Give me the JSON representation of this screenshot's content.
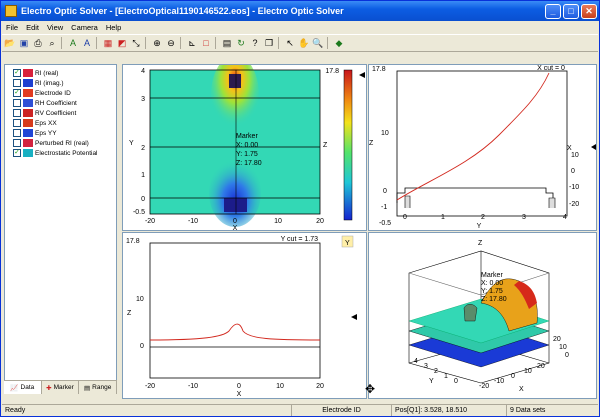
{
  "window": {
    "title": "Electro Optic Solver - [ElectroOptical1190146522.eos] - Electro Optic Solver",
    "minimize": "_",
    "maximize": "□",
    "close": "✕"
  },
  "menu": [
    "File",
    "Edit",
    "View",
    "Camera",
    "Help"
  ],
  "toolbar_icons": [
    "open-icon",
    "save-icon",
    "print-icon",
    "print-preview-icon",
    "text-color-icon",
    "font-icon",
    "grid-icon",
    "image-icon",
    "fit-icon",
    "zoom-in-icon",
    "zoom-out-icon",
    "axes-icon",
    "box-icon",
    "layout-icon",
    "refresh-icon",
    "marker-icon",
    "copy-icon",
    "pointer-icon",
    "pan-icon",
    "zoom-icon",
    "cube-icon"
  ],
  "layers": [
    {
      "label": "RI (real)",
      "checked": true,
      "color": "#d8203a"
    },
    {
      "label": "RI (imag.)",
      "checked": false,
      "color": "#1d3fd1"
    },
    {
      "label": "Electrode ID",
      "checked": true,
      "color": "#e13a20"
    },
    {
      "label": "RH Coefficient",
      "checked": false,
      "color": "#2e4fd6"
    },
    {
      "label": "RV Coefficient",
      "checked": false,
      "color": "#cc2424"
    },
    {
      "label": "Eps XX",
      "checked": false,
      "color": "#d63a1c"
    },
    {
      "label": "Eps YY",
      "checked": false,
      "color": "#1f45d6"
    },
    {
      "label": "Perturbed RI (real)",
      "checked": false,
      "color": "#d2223e"
    },
    {
      "label": "Electrostatic Potential",
      "checked": true,
      "color": "#18b0c2"
    }
  ],
  "left_tabs": [
    "Data",
    "Marker",
    "Range"
  ],
  "plot_main": {
    "x_label": "X",
    "y_label": "Y",
    "z_label": "Z",
    "x_ticks": [
      "-20",
      "-10",
      "0",
      "10",
      "20"
    ],
    "y_ticks": [
      "4",
      "3",
      "2",
      "1",
      "0",
      "-0.5"
    ],
    "z_max": "17.8",
    "marker": {
      "title": "Marker",
      "x": "X: 0.00",
      "y": "Y: 1.75",
      "z": "Z: 17.80"
    }
  },
  "plot_xcut": {
    "title": "X cut = 0",
    "top_value": "17.8",
    "x_label": "Y",
    "y_label": "Z",
    "right_label": "X",
    "x_ticks": [
      "-0.5",
      "0",
      "1",
      "2",
      "3",
      "4"
    ],
    "y_ticks": [
      "10",
      "0",
      "-1"
    ],
    "right_ticks": [
      "10",
      "0",
      "-10",
      "-20"
    ]
  },
  "plot_ycut": {
    "title": "Y cut = 1.73",
    "top_value": "17.8",
    "x_label": "X",
    "y_label": "Z",
    "axis_badge": "Y",
    "x_ticks": [
      "-20",
      "-10",
      "0",
      "10",
      "20"
    ],
    "y_ticks": [
      "10",
      "0"
    ]
  },
  "plot_3d": {
    "z_label": "Z",
    "x_label": "X",
    "y_label": "Y",
    "marker": {
      "title": "Marker",
      "x": "X: 0.00",
      "y": "Y: 1.75",
      "z": "Z: 17.80"
    },
    "ticks_a": [
      "20",
      "10",
      "0"
    ],
    "ticks_y": [
      "4",
      "3",
      "2",
      "1",
      "0"
    ],
    "ticks_x": [
      "-20",
      "-10",
      "0",
      "10",
      "20"
    ]
  },
  "status": {
    "ready": "Ready",
    "dataset": "Electrode ID",
    "pos": "Pos[Q1]: 3.528, 18.510",
    "count": "9 Data sets"
  },
  "colors": {
    "accent": "#0a4fd0",
    "field": "#33d8b5",
    "curve": "#d2281e"
  }
}
